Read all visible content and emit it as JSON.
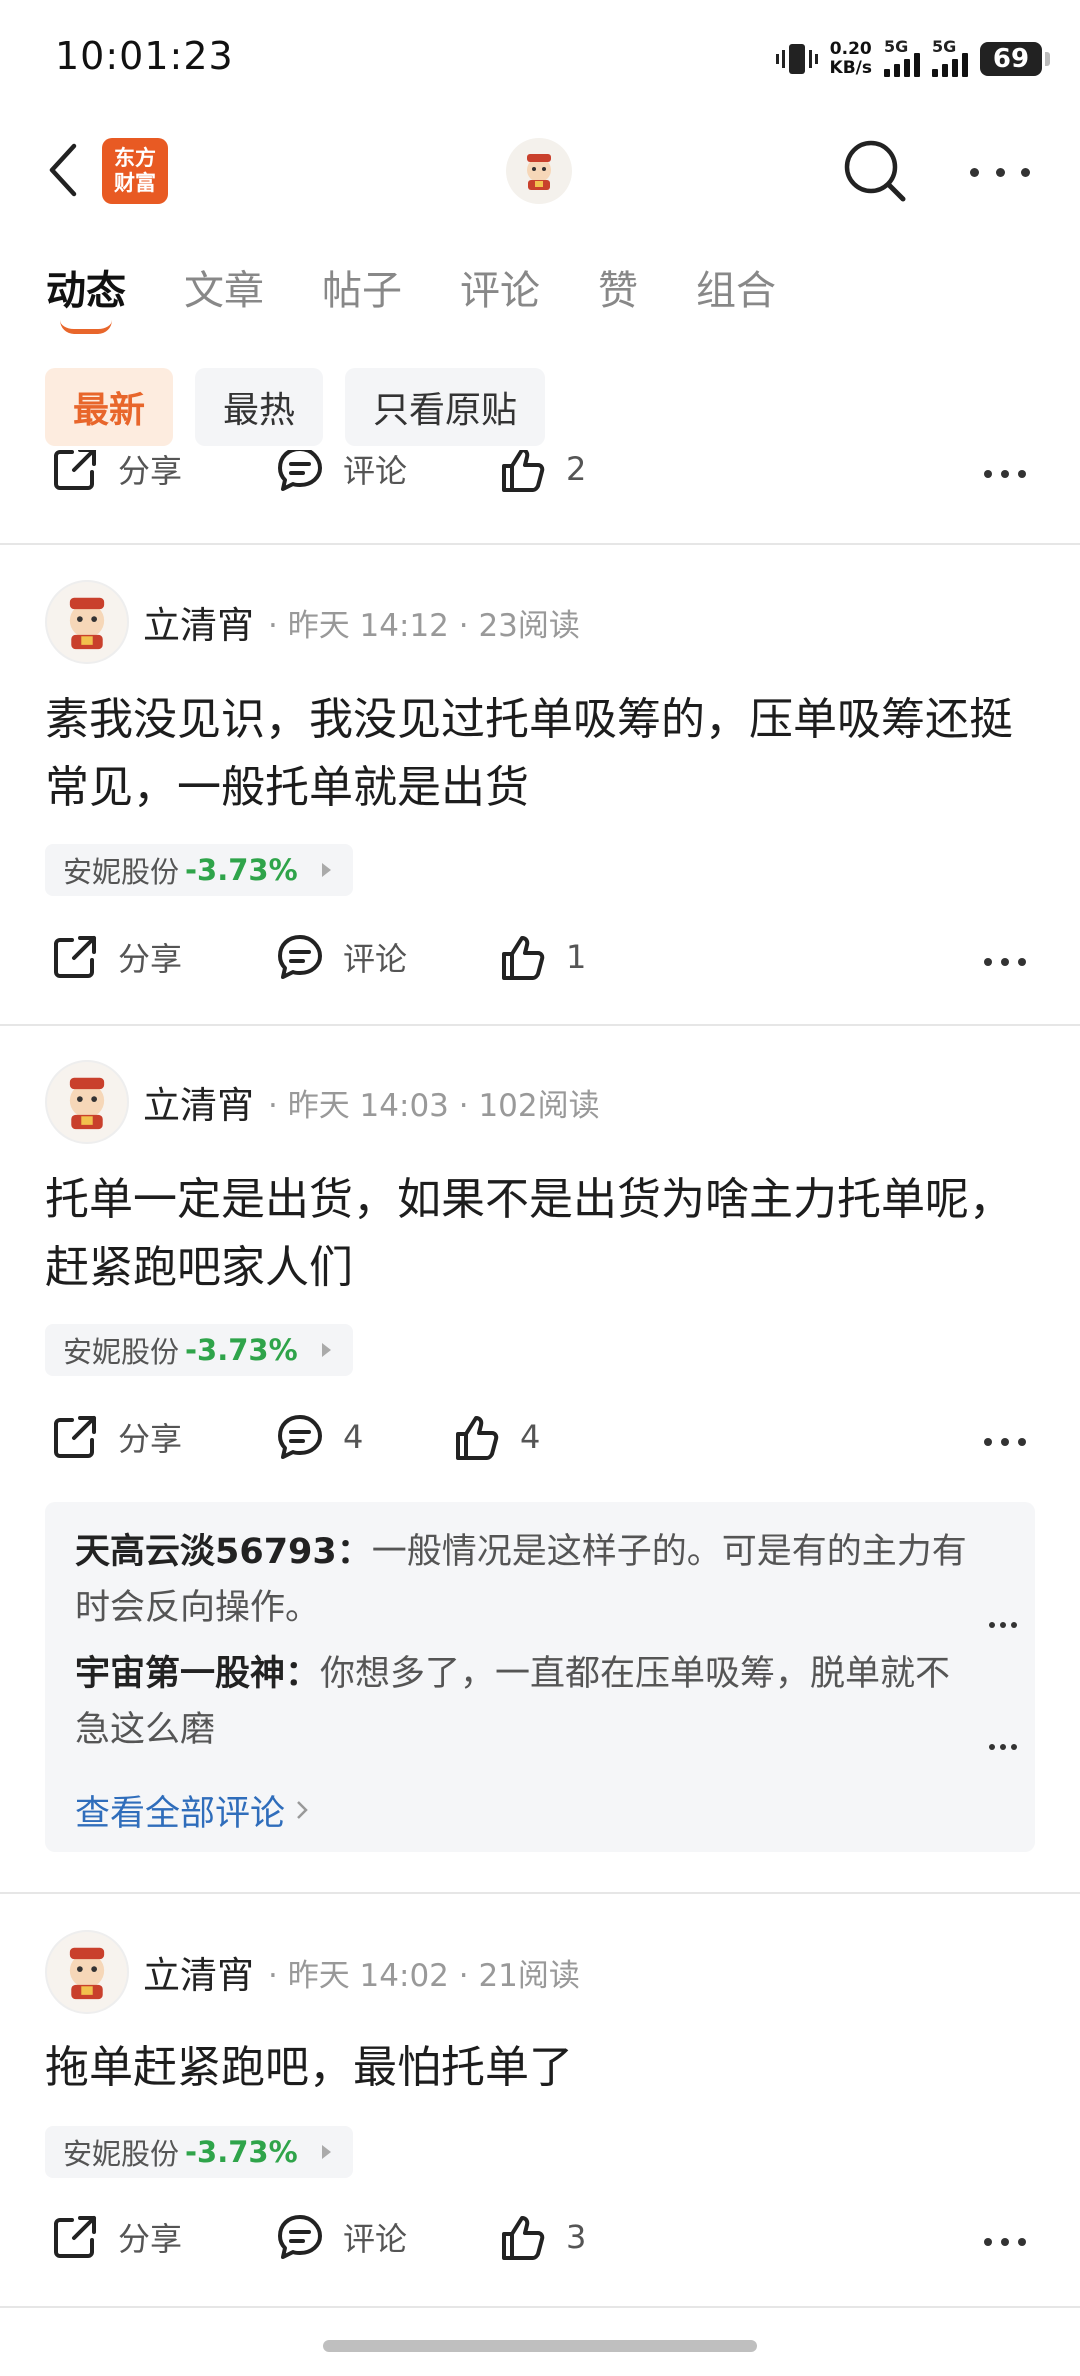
{
  "status_bar": {
    "time": "10:01:23",
    "net_speed_value": "0.20",
    "net_speed_unit": "KB/s",
    "sim1": "5G",
    "sim2": "5G",
    "battery": "69"
  },
  "nav": {
    "logo_line1": "东方",
    "logo_line2": "财富"
  },
  "tabs": [
    "动态",
    "文章",
    "帖子",
    "评论",
    "赞",
    "组合"
  ],
  "filters": [
    "最新",
    "最热",
    "只看原贴"
  ],
  "action_labels": {
    "share": "分享",
    "comment": "评论"
  },
  "partial_post": {
    "likes": "2"
  },
  "posts": [
    {
      "author": "立清宵",
      "meta": "· 昨天 14:12 · 23阅读",
      "text": "素我没见识，我没见过托单吸筹的，压单吸筹还挺常见，一般托单就是出货",
      "stock_name": "安妮股份",
      "stock_change": "-3.73%",
      "comment_label": "评论",
      "likes": "1"
    },
    {
      "author": "立清宵",
      "meta": "· 昨天 14:03 · 102阅读",
      "text": "托单一定是出货，如果不是出货为啥主力托单呢，赶紧跑吧家人们",
      "stock_name": "安妮股份",
      "stock_change": "-3.73%",
      "comment_label": "4",
      "likes": "4",
      "comments": [
        {
          "user": "天高云淡56793：",
          "text": "一般情况是这样子的。可是有的主力有时会反向操作。"
        },
        {
          "user": "宇宙第一股神：",
          "text": "你想多了，一直都在压单吸筹，脱单就不急这么磨"
        }
      ],
      "view_all": "查看全部评论"
    },
    {
      "author": "立清宵",
      "meta": "· 昨天 14:02 · 21阅读",
      "text": "拖单赶紧跑吧，最怕托单了",
      "stock_name": "安妮股份",
      "stock_change": "-3.73%",
      "comment_label": "评论",
      "likes": "3"
    }
  ]
}
